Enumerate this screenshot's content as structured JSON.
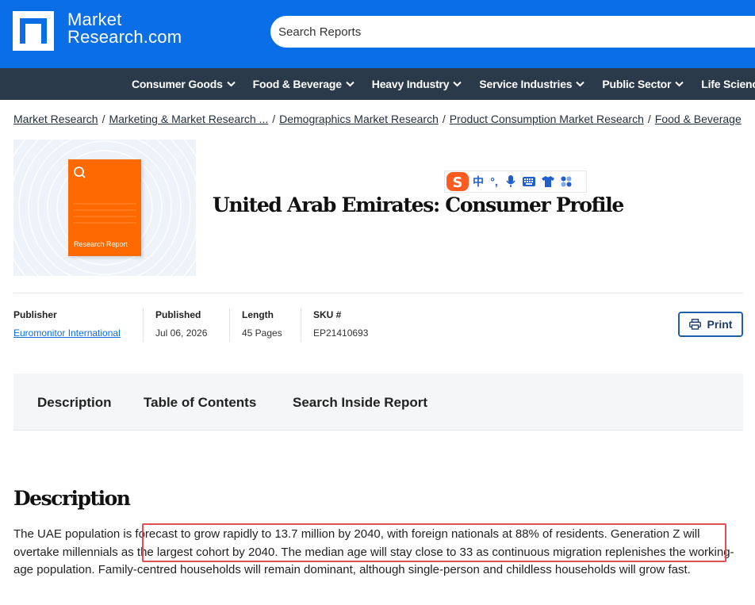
{
  "brand": {
    "line1": "Market",
    "line2": "Research.com"
  },
  "search": {
    "placeholder": "Search Reports"
  },
  "nav": [
    {
      "label": "Consumer Goods"
    },
    {
      "label": "Food & Beverage"
    },
    {
      "label": "Heavy Industry"
    },
    {
      "label": "Service Industries"
    },
    {
      "label": "Public Sector"
    },
    {
      "label": "Life Sciences"
    }
  ],
  "breadcrumb": [
    {
      "label": "Market Research"
    },
    {
      "label": "Marketing & Market Research ..."
    },
    {
      "label": "Demographics Market Research"
    },
    {
      "label": "Product Consumption Market Research"
    },
    {
      "label": "Food & Beverage"
    }
  ],
  "cover": {
    "label": "Research Report"
  },
  "report": {
    "title": "United Arab Emirates: Consumer Profile",
    "publisher_label": "Publisher",
    "publisher": "Euromonitor International",
    "published_label": "Published",
    "published": "Jul 06, 2026",
    "length_label": "Length",
    "length": "45 Pages",
    "sku_label": "SKU #",
    "sku": "EP21410693",
    "print_label": "Print"
  },
  "tabs": [
    {
      "label": "Description"
    },
    {
      "label": "Table of Contents"
    },
    {
      "label": "Search Inside Report"
    }
  ],
  "description": {
    "heading": "Description",
    "text": "The UAE population is forecast to grow rapidly to 13.7 million by 2040, with foreign nationals at 88% of residents. Generation Z will overtake millennials as the largest cohort by 2040. The median age will stay close to 33 as continuous migration replenishes the working-age population. Family-centred households will remain dominant, although single-person and childless households will grow fast."
  },
  "ime": {
    "lang": "中"
  },
  "colors": {
    "header": "#0a6fe6",
    "nav": "#2b3a4a",
    "accent": "#ff6a00",
    "highlight": "#e05050"
  },
  "icons": [
    "logo-mark-icon",
    "chevron-down-icon",
    "magnifier-icon",
    "printer-icon",
    "sogou-icon",
    "microphone-icon",
    "keyboard-icon",
    "shirt-icon",
    "apps-icon"
  ]
}
